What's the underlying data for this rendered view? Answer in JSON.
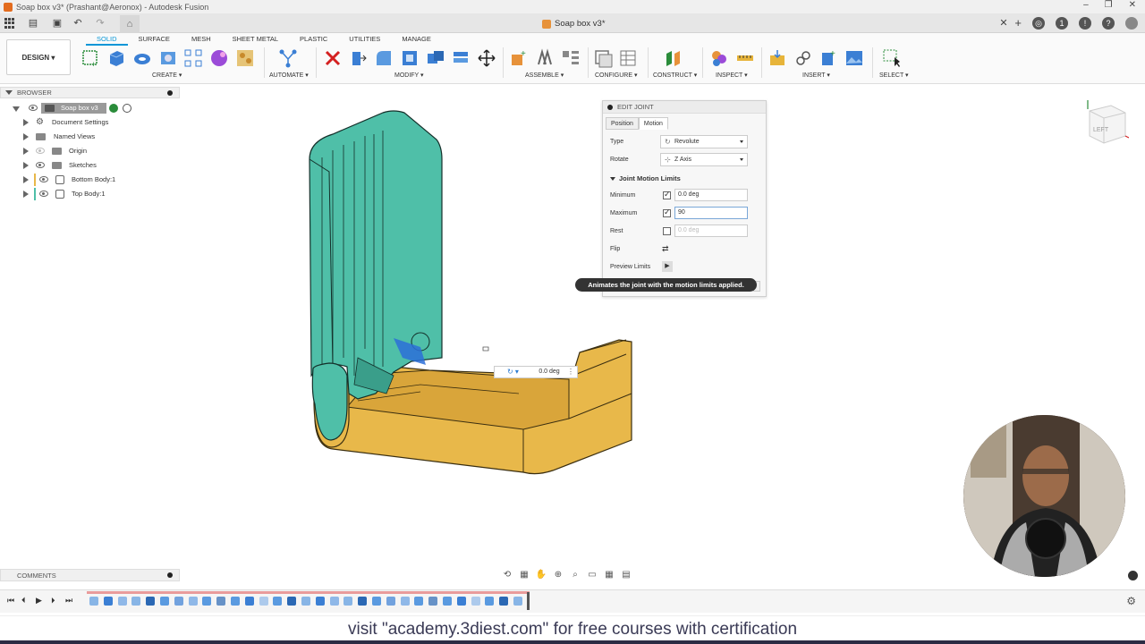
{
  "window": {
    "title": "Soap box v3* (Prashant@Aeronox) - Autodesk Fusion",
    "document_tab": "Soap box v3*"
  },
  "toolbar": {
    "workspace": "DESIGN",
    "tabs": [
      "SOLID",
      "SURFACE",
      "MESH",
      "SHEET METAL",
      "PLASTIC",
      "UTILITIES",
      "MANAGE"
    ],
    "active_tab": "SOLID",
    "groups": {
      "create": "CREATE",
      "automate": "AUTOMATE",
      "modify": "MODIFY",
      "assemble": "ASSEMBLE",
      "configure": "CONFIGURE",
      "construct": "CONSTRUCT",
      "inspect": "INSPECT",
      "insert": "INSERT",
      "select": "SELECT"
    }
  },
  "browser": {
    "title": "BROWSER",
    "root": "Soap box v3",
    "items": [
      {
        "label": "Document Settings"
      },
      {
        "label": "Named Views"
      },
      {
        "label": "Origin"
      },
      {
        "label": "Sketches"
      },
      {
        "label": "Bottom Body:1"
      },
      {
        "label": "Top Body:1"
      }
    ]
  },
  "dialog": {
    "title": "EDIT JOINT",
    "tabs": [
      "Position",
      "Motion"
    ],
    "active_tab": "Motion",
    "type_label": "Type",
    "type_value": "Revolute",
    "rotate_label": "Rotate",
    "rotate_value": "Z Axis",
    "section": "Joint Motion Limits",
    "minimum_label": "Minimum",
    "minimum_value": "0.0 deg",
    "maximum_label": "Maximum",
    "maximum_value": "90",
    "rest_label": "Rest",
    "rest_value": "0.0 deg",
    "flip_label": "Flip",
    "preview_label": "Preview Limits",
    "tooltip": "Animates the joint with the motion limits applied."
  },
  "manipulator": {
    "value": "0.0 deg"
  },
  "viewcube": {
    "face": "LEFT"
  },
  "comments": {
    "title": "COMMENTS"
  },
  "footer": {
    "text": "visit \"academy.3diest.com\" for free courses with certification"
  },
  "colors": {
    "accent": "#0696d7",
    "top_body": "#4fbfa8",
    "bottom_body": "#e8b84a"
  }
}
